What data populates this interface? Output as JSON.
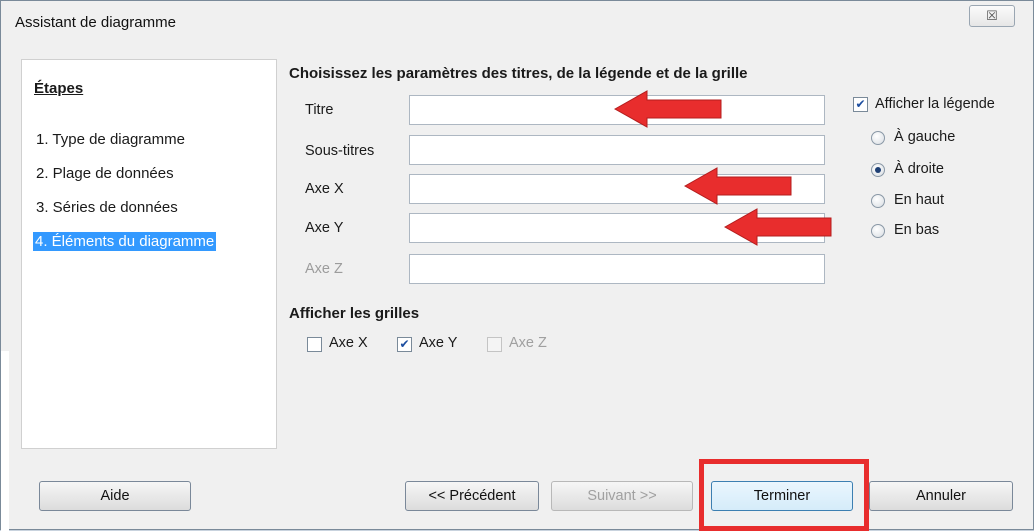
{
  "window": {
    "title": "Assistant de diagramme",
    "close_glyph": "☒"
  },
  "steps": {
    "title": "Étapes",
    "items": [
      {
        "label": "1. Type de diagramme"
      },
      {
        "label": "2. Plage de données"
      },
      {
        "label": "3. Séries de données"
      },
      {
        "label": "4. Éléments du diagramme"
      }
    ]
  },
  "titles_section": {
    "heading": "Choisissez les paramètres des titres, de la légende et de la grille",
    "fields": [
      {
        "label": "Titre",
        "value": ""
      },
      {
        "label": "Sous-titres",
        "value": ""
      },
      {
        "label": "Axe X",
        "value": ""
      },
      {
        "label": "Axe Y",
        "value": ""
      },
      {
        "label": "Axe Z",
        "value": ""
      }
    ]
  },
  "legend": {
    "checkbox_label": "Afficher la légende",
    "checked": true,
    "options": [
      {
        "label": "À gauche",
        "selected": false
      },
      {
        "label": "À droite",
        "selected": true
      },
      {
        "label": "En haut",
        "selected": false
      },
      {
        "label": "En bas",
        "selected": false
      }
    ]
  },
  "grids": {
    "heading": "Afficher les grilles",
    "items": [
      {
        "label": "Axe X",
        "checked": false
      },
      {
        "label": "Axe Y",
        "checked": true
      },
      {
        "label": "Axe Z",
        "checked": false
      }
    ]
  },
  "buttons": {
    "help": "Aide",
    "previous": "<< Précédent",
    "next": "Suivant >>",
    "finish": "Terminer",
    "cancel": "Annuler"
  },
  "colors": {
    "accent": "#3399ff",
    "annotation_red": "#e82d2d"
  }
}
